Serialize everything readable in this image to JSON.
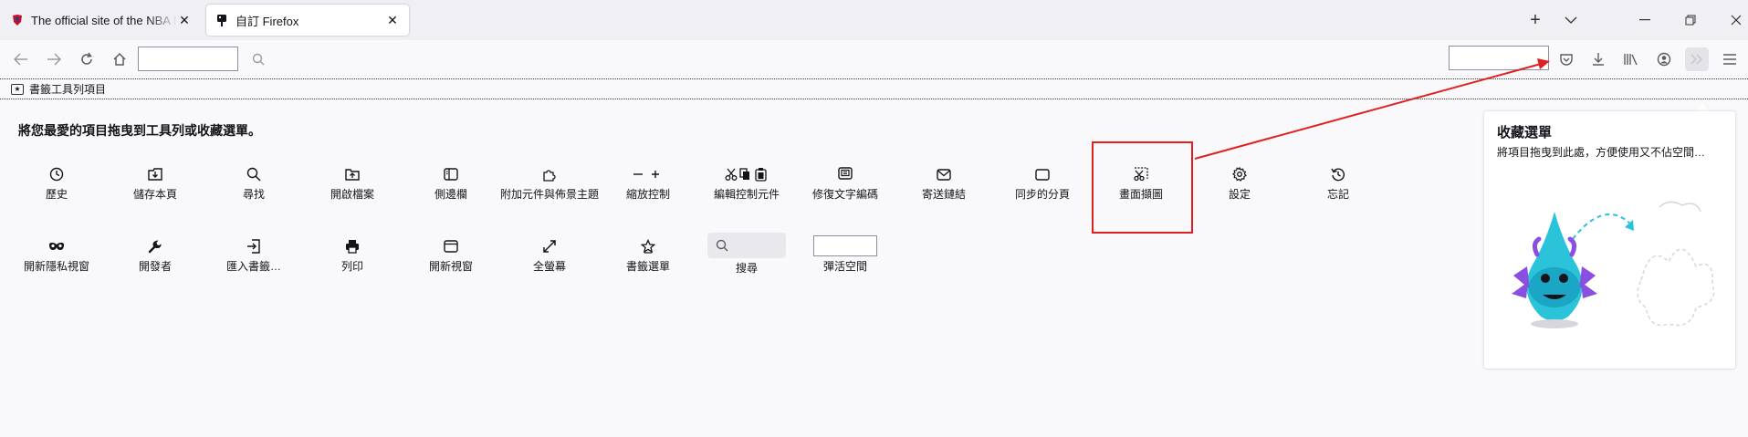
{
  "tabs": [
    {
      "title": "The official site of the NBA for",
      "close": "✕"
    },
    {
      "title": "自訂 Firefox",
      "close": "✕"
    }
  ],
  "window": {
    "new_tab": "+",
    "list_tabs": "⌵",
    "minimize": "—",
    "restore": "❐",
    "close": "✕"
  },
  "bookmarks_toolbar": {
    "label": "書籤工具列項目"
  },
  "customize": {
    "heading": "將您最愛的項目拖曳到工具列或收藏選單。",
    "row1": [
      {
        "id": "history",
        "label": "歷史",
        "icon": "clock-icon"
      },
      {
        "id": "save-page",
        "label": "儲存本頁",
        "icon": "save-page-icon"
      },
      {
        "id": "find",
        "label": "尋找",
        "icon": "search-icon"
      },
      {
        "id": "open-file",
        "label": "開啟檔案",
        "icon": "folder-icon"
      },
      {
        "id": "sidebar",
        "label": "側邊欄",
        "icon": "sidebar-icon"
      },
      {
        "id": "addons-themes",
        "label": "附加元件與佈景主題",
        "icon": "puzzle-icon"
      },
      {
        "id": "zoom",
        "label": "縮放控制",
        "icon": "zoom-icon"
      },
      {
        "id": "edit",
        "label": "編輯控制元件",
        "icon": "cut-copy-paste-icon"
      },
      {
        "id": "text-encoding",
        "label": "修復文字編碼",
        "icon": "text-encoding-icon"
      },
      {
        "id": "email-link",
        "label": "寄送鏈結",
        "icon": "mail-icon"
      },
      {
        "id": "synced-tabs",
        "label": "同步的分頁",
        "icon": "synced-tabs-icon"
      },
      {
        "id": "screenshot",
        "label": "畫面擷圖",
        "icon": "screenshot-icon"
      },
      {
        "id": "settings",
        "label": "設定",
        "icon": "gear-icon"
      },
      {
        "id": "forget",
        "label": "忘記",
        "icon": "forget-icon"
      }
    ],
    "row2": [
      {
        "id": "private-window",
        "label": "開新隱私視窗",
        "icon": "private-mask-icon"
      },
      {
        "id": "developer",
        "label": "開發者",
        "icon": "wrench-icon"
      },
      {
        "id": "import-bookmarks",
        "label": "匯入書籤…",
        "icon": "import-icon"
      },
      {
        "id": "print",
        "label": "列印",
        "icon": "printer-icon"
      },
      {
        "id": "new-window",
        "label": "開新視窗",
        "icon": "window-icon"
      },
      {
        "id": "fullscreen",
        "label": "全螢幕",
        "icon": "fullscreen-icon"
      },
      {
        "id": "bookmarks-menu",
        "label": "書籤選單",
        "icon": "star-icon"
      },
      {
        "id": "search",
        "label": "搜尋",
        "icon": "search-field"
      },
      {
        "id": "flexible-space",
        "label": "彈活空間",
        "icon": "flex-space"
      }
    ]
  },
  "overflow_panel": {
    "title": "收藏選單",
    "description": "將項目拖曳到此處，方便使用又不佔空間…"
  },
  "colors": {
    "annotation_red": "#e02020"
  }
}
